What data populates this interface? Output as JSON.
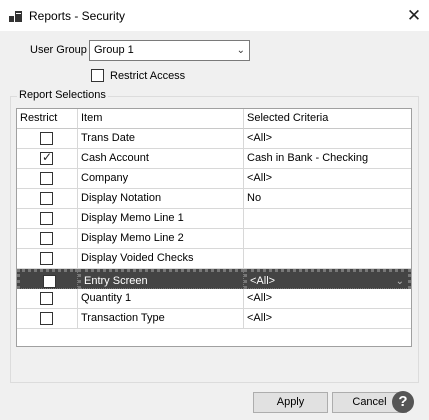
{
  "window": {
    "title": "Reports - Security",
    "close_symbol": "✕"
  },
  "form": {
    "user_group_label": "User Group",
    "user_group_value": "Group 1",
    "restrict_access_label": "Restrict Access",
    "restrict_access_checked": false
  },
  "report_selections": {
    "title": "Report Selections",
    "columns": [
      "Restrict",
      "Item",
      "Selected Criteria"
    ],
    "rows": [
      {
        "restrict": false,
        "item": "Trans Date",
        "criteria": "<All>"
      },
      {
        "restrict": true,
        "item": "Cash Account",
        "criteria": "Cash in Bank - Checking"
      },
      {
        "restrict": false,
        "item": "Company",
        "criteria": "<All>"
      },
      {
        "restrict": false,
        "item": "Display Notation",
        "criteria": "No"
      },
      {
        "restrict": false,
        "item": "Display Memo Line 1",
        "criteria": ""
      },
      {
        "restrict": false,
        "item": "Display Memo Line 2",
        "criteria": ""
      },
      {
        "restrict": false,
        "item": "Display Voided Checks",
        "criteria": ""
      },
      {
        "restrict": false,
        "item": "Entry Screen",
        "criteria": "<All>",
        "selected": true
      },
      {
        "restrict": false,
        "item": "Quantity 1",
        "criteria": "<All>"
      },
      {
        "restrict": false,
        "item": "Transaction Type",
        "criteria": "<All>"
      }
    ]
  },
  "buttons": {
    "apply": "Apply",
    "cancel": "Cancel",
    "help": "?"
  },
  "icons": {
    "app": "reports-app-icon",
    "dropdown": "chevron-down-icon",
    "help": "help-icon"
  }
}
